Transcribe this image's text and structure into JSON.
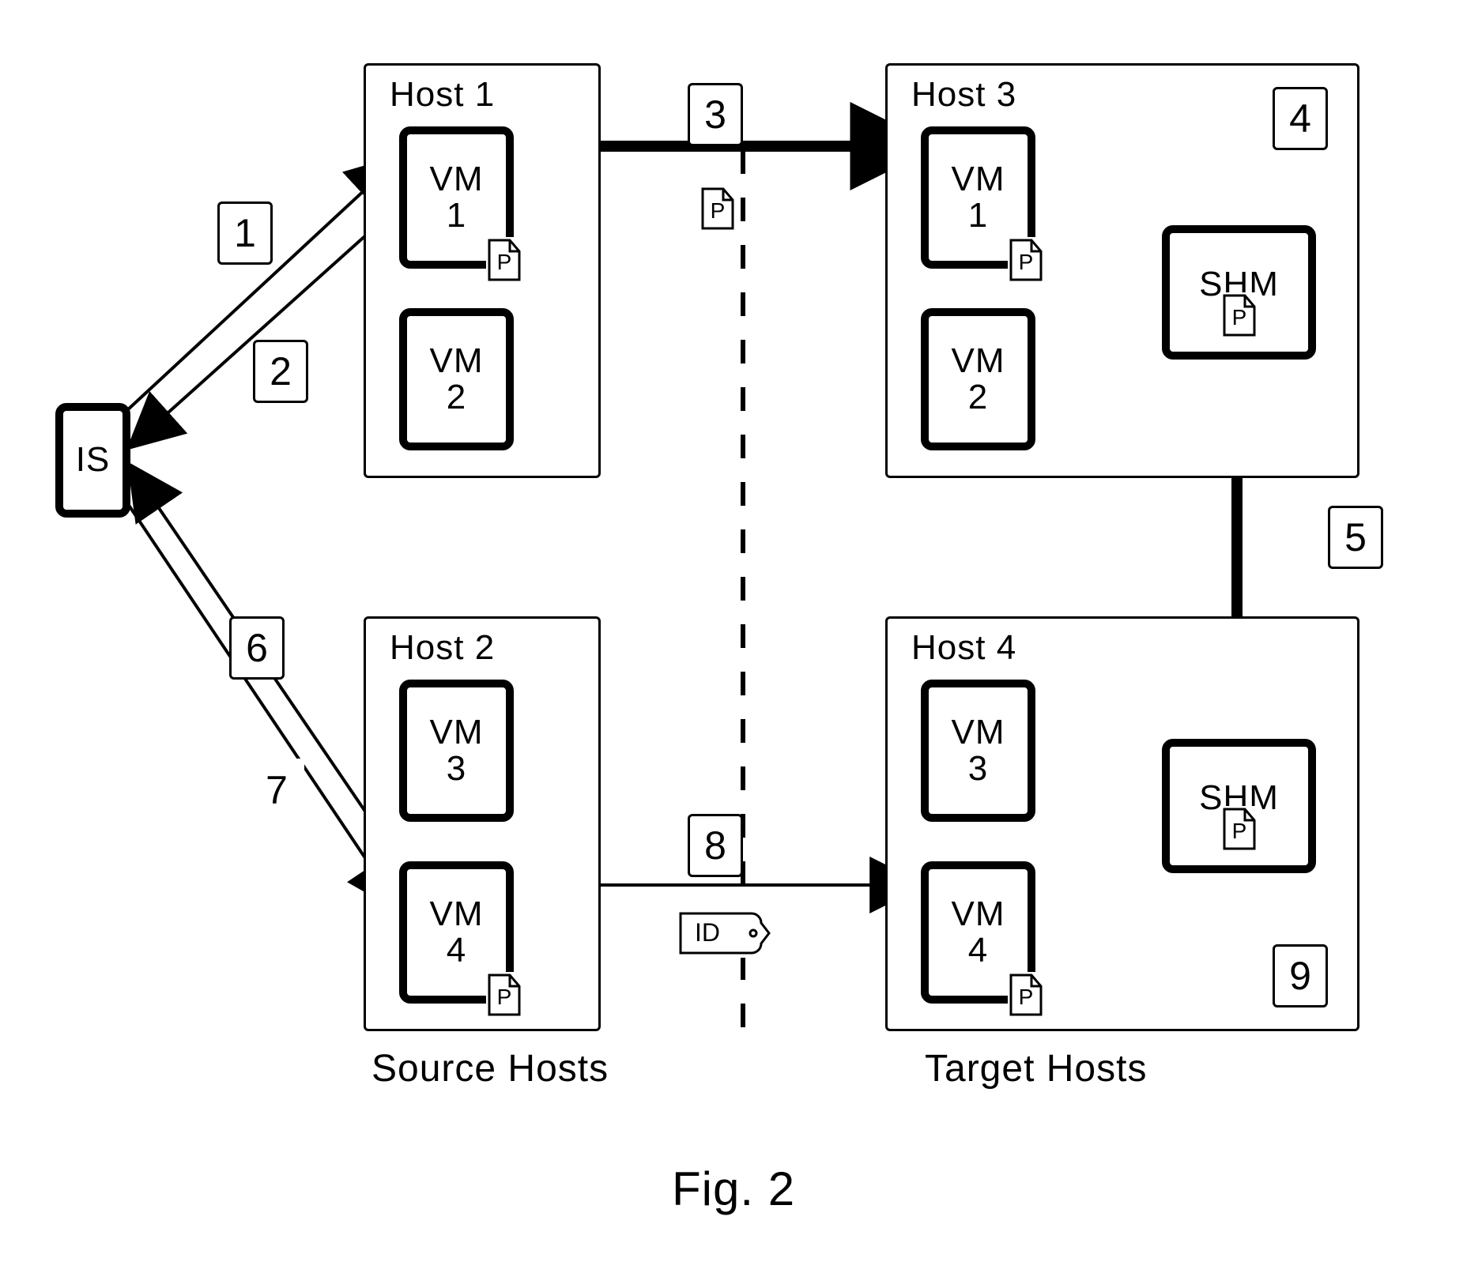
{
  "figure_caption": "Fig. 2",
  "group_labels": {
    "source": "Source Hosts",
    "target": "Target Hosts"
  },
  "is_label": "IS",
  "hosts": {
    "h1": "Host 1",
    "h2": "Host 2",
    "h3": "Host 3",
    "h4": "Host 4"
  },
  "vms": {
    "vm1a": "VM\n1",
    "vm2a": "VM\n2",
    "vm3a": "VM\n3",
    "vm4a": "VM\n4",
    "vm1b": "VM\n1",
    "vm2b": "VM\n2",
    "vm3b": "VM\n3",
    "vm4b": "VM\n4"
  },
  "shm": {
    "shm3": "SHM",
    "shm4": "SHM"
  },
  "steps": {
    "s1": "1",
    "s2": "2",
    "s3": "3",
    "s4": "4",
    "s5": "5",
    "s6": "6",
    "s7": "7",
    "s8": "8",
    "s9": "9"
  },
  "doc_label": "P",
  "id_tag": "ID",
  "chart_data": {
    "type": "diagram",
    "title": "Fig. 2",
    "nodes": [
      {
        "id": "IS",
        "label": "IS"
      },
      {
        "id": "Host1",
        "label": "Host 1",
        "group": "Source Hosts",
        "contains": [
          "VM1",
          "VM2"
        ]
      },
      {
        "id": "Host2",
        "label": "Host 2",
        "group": "Source Hosts",
        "contains": [
          "VM3",
          "VM4"
        ]
      },
      {
        "id": "Host3",
        "label": "Host 3",
        "group": "Target Hosts",
        "contains": [
          "VM1",
          "VM2",
          "SHM"
        ]
      },
      {
        "id": "Host4",
        "label": "Host 4",
        "group": "Target Hosts",
        "contains": [
          "VM3",
          "VM4",
          "SHM"
        ]
      }
    ],
    "edges": [
      {
        "step": 1,
        "from": "IS",
        "to": "Host1.VM1",
        "style": "thin"
      },
      {
        "step": 2,
        "from": "Host1.VM1",
        "to": "IS",
        "style": "thin"
      },
      {
        "step": 3,
        "from": "Host1.VM1",
        "to": "Host3.VM1",
        "style": "bold",
        "payload": "P"
      },
      {
        "step": 4,
        "from": "Host3.VM1",
        "to": "Host3.SHM",
        "style": "bold"
      },
      {
        "step": 5,
        "from": "Host3.SHM",
        "to": "Host4.SHM",
        "style": "bold"
      },
      {
        "step": 6,
        "from": "Host2.VM4",
        "to": "IS",
        "style": "thin"
      },
      {
        "step": 7,
        "from": "IS",
        "to": "Host2.VM4",
        "style": "thin"
      },
      {
        "step": 8,
        "from": "Host2.VM4",
        "to": "Host4.VM4",
        "style": "thin",
        "payload": "ID"
      },
      {
        "step": 9,
        "from": "Host4.SHM",
        "to": "Host4.VM4",
        "style": "bold",
        "payload": "P"
      }
    ]
  }
}
